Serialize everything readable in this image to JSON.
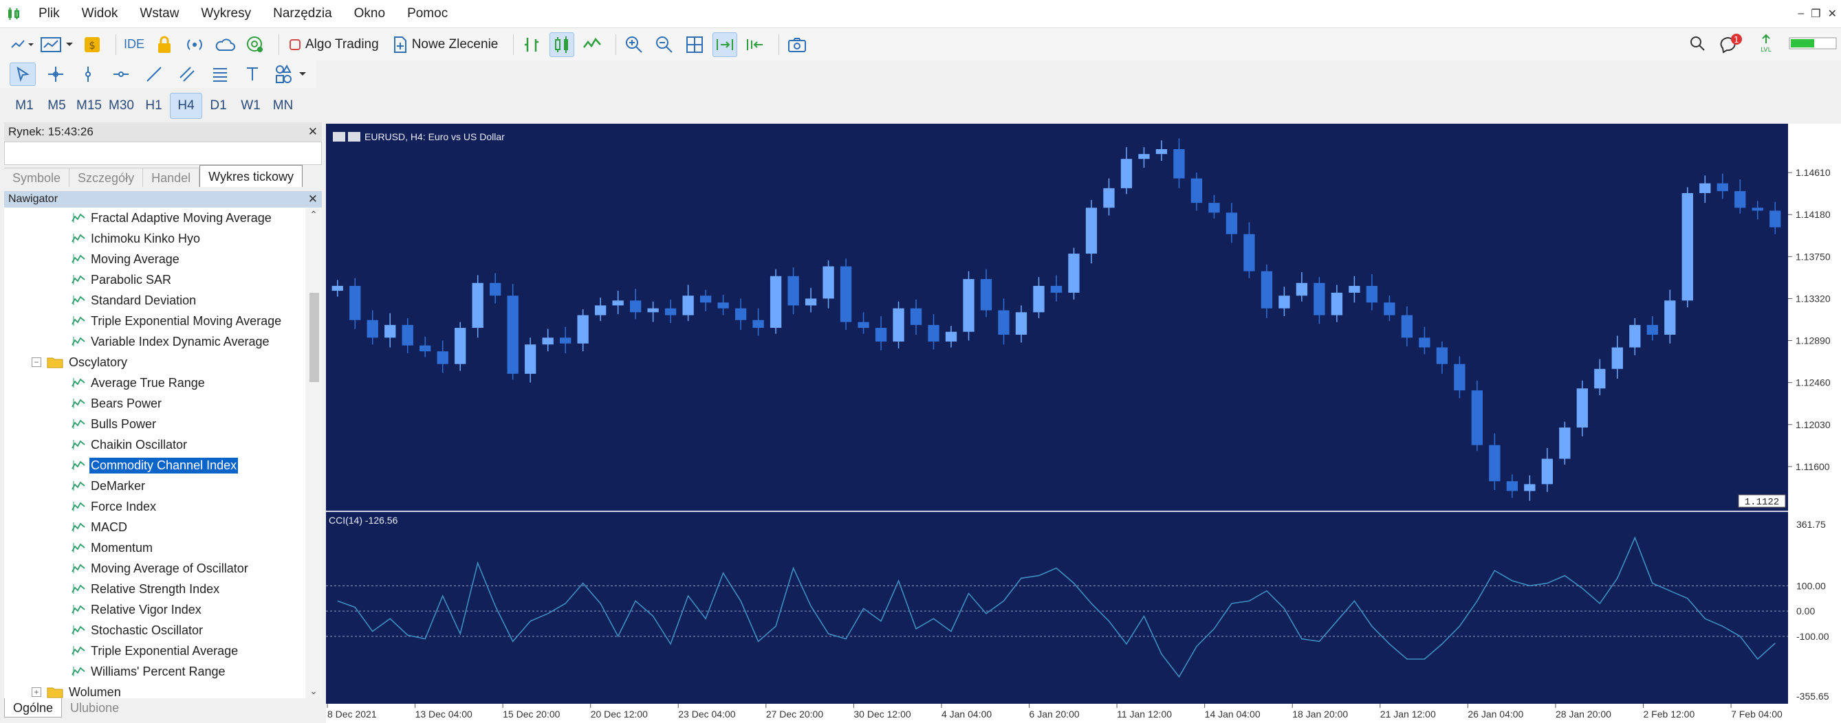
{
  "menubar": {
    "items": [
      "Plik",
      "Widok",
      "Wstaw",
      "Wykresy",
      "Narzędzia",
      "Okno",
      "Pomoc"
    ]
  },
  "toolbar": {
    "ide_label": "IDE",
    "algo_label": "Algo Trading",
    "new_order_label": "Nowe Zlecenie",
    "notification_count": "1"
  },
  "timeframes": [
    "M1",
    "M5",
    "M15",
    "M30",
    "H1",
    "H4",
    "D1",
    "W1",
    "MN"
  ],
  "timeframe_active": "H4",
  "market_watch": {
    "title": "Rynek: 15:43:26",
    "tabs": [
      "Symbole",
      "Szczegóły",
      "Handel",
      "Wykres tickowy"
    ],
    "active_tab": "Wykres tickowy"
  },
  "navigator": {
    "title": "Nawigator",
    "items": [
      {
        "label": "Fractal Adaptive Moving Average",
        "type": "indicator"
      },
      {
        "label": "Ichimoku Kinko Hyo",
        "type": "indicator"
      },
      {
        "label": "Moving Average",
        "type": "indicator"
      },
      {
        "label": "Parabolic SAR",
        "type": "indicator"
      },
      {
        "label": "Standard Deviation",
        "type": "indicator"
      },
      {
        "label": "Triple Exponential Moving Average",
        "type": "indicator"
      },
      {
        "label": "Variable Index Dynamic Average",
        "type": "indicator"
      },
      {
        "label": "Oscylatory",
        "type": "folder"
      },
      {
        "label": "Average True Range",
        "type": "indicator"
      },
      {
        "label": "Bears Power",
        "type": "indicator"
      },
      {
        "label": "Bulls Power",
        "type": "indicator"
      },
      {
        "label": "Chaikin Oscillator",
        "type": "indicator"
      },
      {
        "label": "Commodity Channel Index",
        "type": "indicator",
        "selected": true
      },
      {
        "label": "DeMarker",
        "type": "indicator"
      },
      {
        "label": "Force Index",
        "type": "indicator"
      },
      {
        "label": "MACD",
        "type": "indicator"
      },
      {
        "label": "Momentum",
        "type": "indicator"
      },
      {
        "label": "Moving Average of Oscillator",
        "type": "indicator"
      },
      {
        "label": "Relative Strength Index",
        "type": "indicator"
      },
      {
        "label": "Relative Vigor Index",
        "type": "indicator"
      },
      {
        "label": "Stochastic Oscillator",
        "type": "indicator"
      },
      {
        "label": "Triple Exponential Average",
        "type": "indicator"
      },
      {
        "label": "Williams' Percent Range",
        "type": "indicator"
      },
      {
        "label": "Wolumen",
        "type": "folder-collapsed"
      }
    ],
    "bottom_tabs": [
      "Ogólne",
      "Ulubione"
    ]
  },
  "chart": {
    "title": "EURUSD, H4:  Euro vs US Dollar",
    "price_ticks": [
      "1.14610",
      "1.14180",
      "1.13750",
      "1.13320",
      "1.12890",
      "1.12460",
      "1.12030",
      "1.11600"
    ],
    "price_range": [
      1.1117,
      1.1504
    ],
    "current_price_tag": "1.1122",
    "cci_label": "CCI(14) -126.56",
    "cci_ticks": [
      "361.75",
      "100.00",
      "0.00",
      "-100.00",
      "-355.65"
    ],
    "cci_range": [
      -355.65,
      361.75
    ],
    "date_ticks": [
      "8 Dec 2021",
      "13 Dec 04:00",
      "15 Dec 20:00",
      "20 Dec 12:00",
      "23 Dec 04:00",
      "27 Dec 20:00",
      "30 Dec 12:00",
      "4 Jan 04:00",
      "6 Jan 20:00",
      "11 Jan 12:00",
      "14 Jan 04:00",
      "18 Jan 20:00",
      "21 Jan 12:00",
      "26 Jan 04:00",
      "28 Jan 20:00",
      "2 Feb 12:00",
      "7 Feb 04:00"
    ],
    "colors": {
      "background": "#12205a",
      "bull": "#6ea8ff",
      "bear": "#2f6fd6",
      "cci": "#3d8fc0",
      "grid": "#8e9ac0"
    }
  },
  "chart_data": {
    "type": "line",
    "title": "EURUSD, H4:  Euro vs US Dollar",
    "x_tick_labels": [
      "8 Dec 2021",
      "13 Dec 04:00",
      "15 Dec 20:00",
      "20 Dec 12:00",
      "23 Dec 04:00",
      "27 Dec 20:00",
      "30 Dec 12:00",
      "4 Jan 04:00",
      "6 Jan 20:00",
      "11 Jan 12:00",
      "14 Jan 04:00",
      "18 Jan 20:00",
      "21 Jan 12:00",
      "26 Jan 04:00",
      "28 Jan 20:00",
      "2 Feb 12:00",
      "7 Feb 04:00"
    ],
    "series": [
      {
        "name": "EURUSD",
        "values": [
          1.1345,
          1.131,
          1.1292,
          1.1305,
          1.1284,
          1.1278,
          1.1265,
          1.1302,
          1.1348,
          1.1335,
          1.1255,
          1.1285,
          1.1292,
          1.1286,
          1.1315,
          1.1325,
          1.133,
          1.1318,
          1.1322,
          1.1315,
          1.1335,
          1.1328,
          1.1322,
          1.131,
          1.1302,
          1.1355,
          1.1325,
          1.1332,
          1.1365,
          1.1308,
          1.1302,
          1.1288,
          1.1322,
          1.1305,
          1.1288,
          1.1298,
          1.1352,
          1.132,
          1.1295,
          1.1318,
          1.1345,
          1.1338,
          1.1378,
          1.1425,
          1.1445,
          1.1475,
          1.148,
          1.1485,
          1.1455,
          1.143,
          1.142,
          1.1398,
          1.136,
          1.1322,
          1.1335,
          1.1348,
          1.1315,
          1.1338,
          1.1345,
          1.1328,
          1.1315,
          1.1292,
          1.1282,
          1.1265,
          1.1238,
          1.1182,
          1.1145,
          1.1135,
          1.1142,
          1.1168,
          1.12,
          1.124,
          1.126,
          1.1282,
          1.1305,
          1.1295,
          1.133,
          1.144,
          1.145,
          1.1442,
          1.1425,
          1.1422,
          1.1405
        ]
      },
      {
        "name": "CCI(14)",
        "values": [
          40,
          15,
          -80,
          -30,
          -95,
          -110,
          60,
          -90,
          190,
          20,
          -120,
          -40,
          -10,
          30,
          110,
          30,
          -100,
          40,
          -20,
          -130,
          60,
          -30,
          150,
          40,
          -120,
          -60,
          170,
          20,
          -90,
          -110,
          10,
          -40,
          120,
          -70,
          -30,
          -80,
          70,
          -10,
          40,
          130,
          140,
          170,
          110,
          30,
          -40,
          -130,
          -20,
          -170,
          -260,
          -140,
          -70,
          30,
          40,
          80,
          10,
          -110,
          -120,
          -40,
          40,
          -60,
          -130,
          -190,
          -190,
          -130,
          -60,
          40,
          160,
          120,
          100,
          110,
          140,
          90,
          30,
          130,
          290,
          110,
          80,
          50,
          -30,
          -60,
          -100,
          -190,
          -127
        ]
      }
    ],
    "ylabel": "",
    "xlabel": ""
  }
}
